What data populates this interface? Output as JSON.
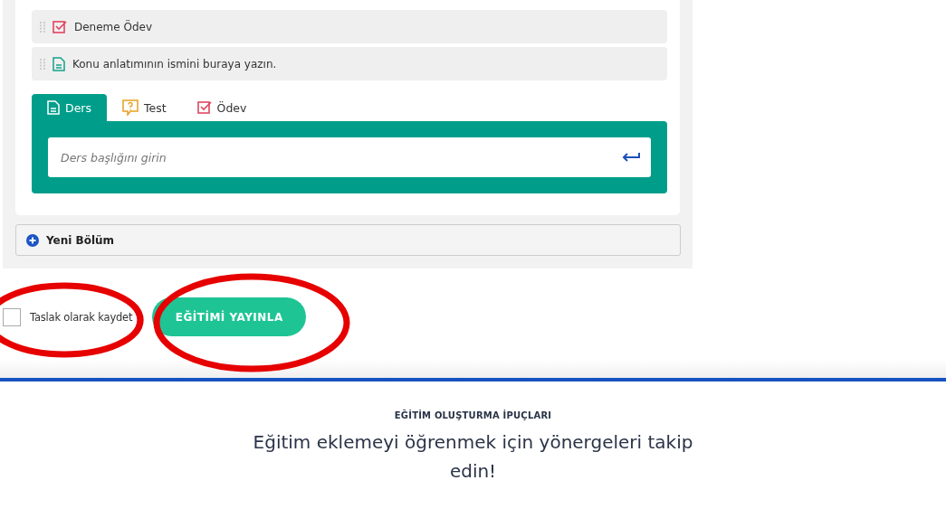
{
  "items": [
    {
      "kind": "odev",
      "title": "Deneme Ödev"
    },
    {
      "kind": "ders",
      "title": "Konu anlatımının ismini buraya yazın."
    }
  ],
  "tabs": [
    {
      "kind": "ders",
      "label": "Ders",
      "selected": true
    },
    {
      "kind": "test",
      "label": "Test",
      "selected": false
    },
    {
      "kind": "odev",
      "label": "Ödev",
      "selected": false
    }
  ],
  "lesson_input": {
    "placeholder": "Ders başlığını girin"
  },
  "new_section": {
    "label": "Yeni Bölüm"
  },
  "draft": {
    "label": "Taslak olarak kaydet",
    "checked": false
  },
  "publish_button": {
    "label": "EĞİTİMİ YAYINLA"
  },
  "tips": {
    "eyebrow": "EĞİTİM OLUŞTURMA İPUÇLARI",
    "heading": "Eğitim eklemeyi öğrenmek için yönergeleri takip edin!"
  }
}
